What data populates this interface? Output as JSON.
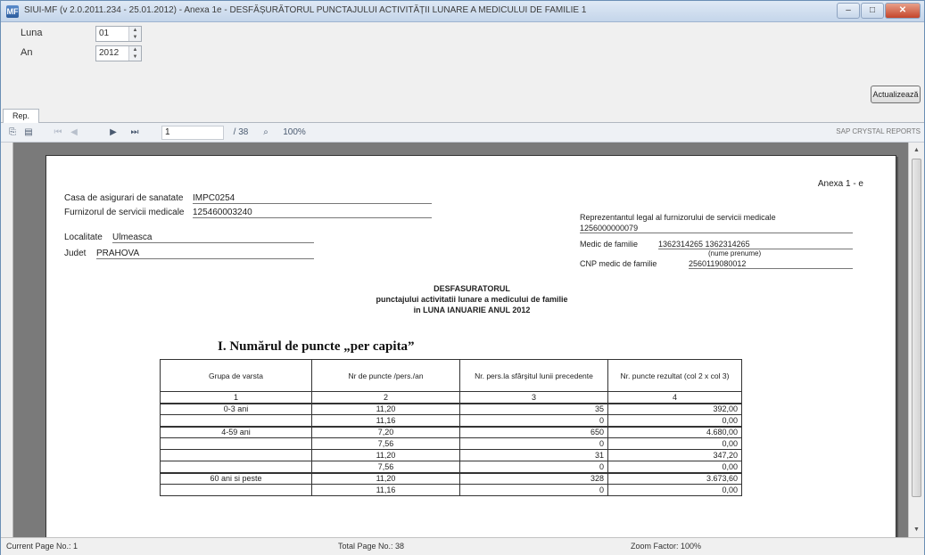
{
  "window": {
    "title": "SIUI-MF (v 2.0.2011.234 - 25.01.2012) - Anexa 1e - DESFĂȘURĂTORUL PUNCTAJULUI ACTIVITĂȚII LUNARE A MEDICULUI DE FAMILIE 1",
    "app_icon_label": "MF",
    "minimize_label": "–",
    "maximize_label": "□",
    "close_label": "✕"
  },
  "params": {
    "month_label": "Luna",
    "month_value": "01",
    "year_label": "An",
    "year_value": "2012",
    "refresh_label": "Actualizează"
  },
  "tabs": [
    {
      "label": "Rep."
    }
  ],
  "toolbar": {
    "page_value": "1",
    "of_pages": "/ 38",
    "zoom_label": "100%",
    "search_label": "SAP CRYSTAL REPORTS"
  },
  "report": {
    "annex_label": "Anexa 1 - e",
    "insurer_label": "Casa de asigurari de sanatate",
    "insurer_value": "IMPC0254",
    "provider_label": "Furnizorul de servicii medicale",
    "provider_value": "125460003240",
    "locality_label": "Localitate",
    "locality_value": "Ulmeasca",
    "county_label": "Judet",
    "county_value": "PRAHOVA",
    "rep_label": "Reprezentantul legal al furnizorului de servicii medicale",
    "rep_value": "1256000000079",
    "doctor_label": "Medic de familie",
    "doctor_value": "1362314265 1362314265",
    "doctor_note": "(nume prenume)",
    "cnp_label": "CNP medic de familie",
    "cnp_value": "2560119080012",
    "heading1": "DESFASURATORUL",
    "heading2": "punctajului activitatii lunare a medicului de familie",
    "heading3": "in LUNA IANUARIE ANUL 2012",
    "section_title": "I. Numărul de puncte „per capita”",
    "columns": [
      "Grupa de varsta",
      "Nr de puncte /pers./an",
      "Nr. pers.la sfârşitul lunii precedente",
      "Nr. puncte rezultat (col 2 x col 3)"
    ],
    "col_numbers": [
      "1",
      "2",
      "3",
      "4"
    ],
    "rows": [
      {
        "group": "0-3 ani",
        "pts": "11,20",
        "pers": "35",
        "total": "392,00",
        "thick": true
      },
      {
        "group": "",
        "pts": "11,16",
        "pers": "0",
        "total": "0,00",
        "thick": false
      },
      {
        "group": "4-59 ani",
        "pts": "7,20",
        "pers": "650",
        "total": "4.680,00",
        "thick": true
      },
      {
        "group": "",
        "pts": "7,56",
        "pers": "0",
        "total": "0,00",
        "thick": false
      },
      {
        "group": "",
        "pts": "11,20",
        "pers": "31",
        "total": "347,20",
        "thick": false
      },
      {
        "group": "",
        "pts": "7,56",
        "pers": "0",
        "total": "0,00",
        "thick": false
      },
      {
        "group": "60 ani si peste",
        "pts": "11,20",
        "pers": "328",
        "total": "3.673,60",
        "thick": true
      },
      {
        "group": "",
        "pts": "11,16",
        "pers": "0",
        "total": "0,00",
        "thick": false
      }
    ]
  },
  "status": {
    "current_page": "Current Page No.: 1",
    "total_page": "Total Page No.: 38",
    "zoom": "Zoom Factor: 100%"
  }
}
